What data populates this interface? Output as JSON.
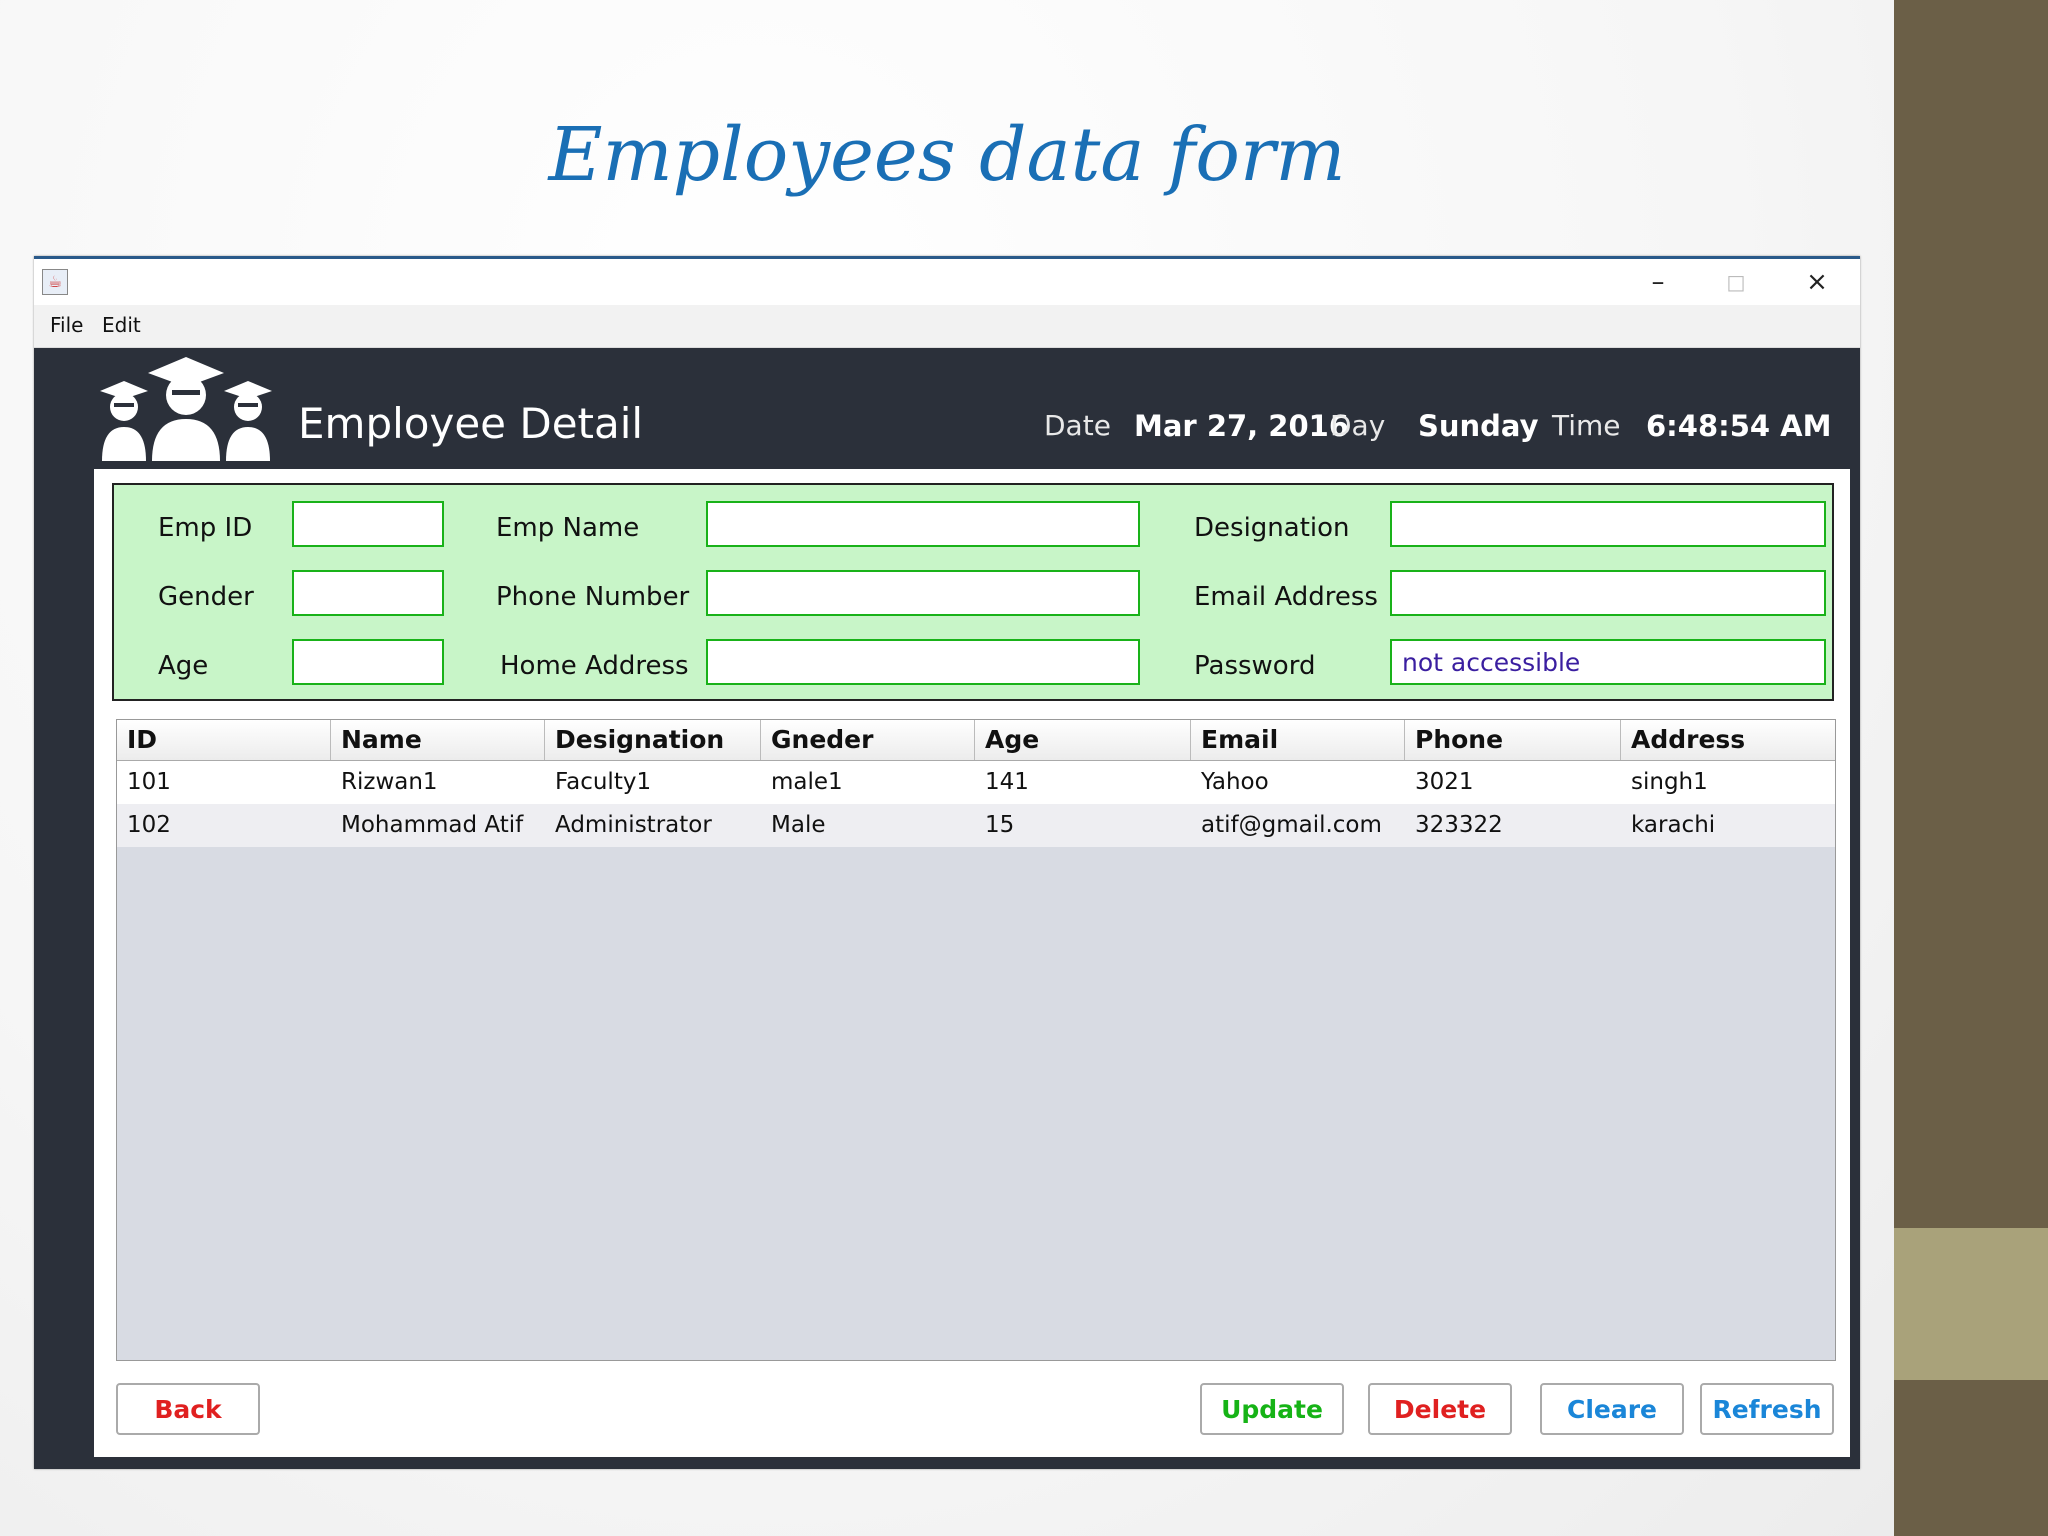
{
  "slide": {
    "title": "Employees data form"
  },
  "window": {
    "menu": [
      "File",
      "Edit"
    ],
    "controls": {
      "minimize": "–",
      "maximize": "□",
      "close": "×"
    }
  },
  "header": {
    "title": "Employee Detail",
    "icon": "graduates-icon",
    "date_label": "Date",
    "date_value": "Mar 27, 2016",
    "day_label": "Day",
    "day_value": "Sunday",
    "time_label": "Time",
    "time_value": "6:48:54 AM"
  },
  "form": {
    "emp_id": {
      "label": "Emp ID",
      "value": ""
    },
    "emp_name": {
      "label": "Emp Name",
      "value": ""
    },
    "designation": {
      "label": "Designation",
      "value": ""
    },
    "gender": {
      "label": "Gender",
      "value": ""
    },
    "phone": {
      "label": "Phone Number",
      "value": ""
    },
    "email": {
      "label": "Email Address",
      "value": ""
    },
    "age": {
      "label": "Age",
      "value": ""
    },
    "address": {
      "label": "Home Address",
      "value": ""
    },
    "password": {
      "label": "Password",
      "value": "not accessible"
    }
  },
  "table": {
    "columns": [
      "ID",
      "Name",
      "Designation",
      "Gneder",
      "Age",
      "Email",
      "Phone",
      "Address"
    ],
    "rows": [
      [
        "101",
        "Rizwan1",
        "Faculty1",
        "male1",
        "141",
        "Yahoo",
        "3021",
        "singh1"
      ],
      [
        "102",
        "Mohammad Atif",
        "Administrator",
        "Male",
        "15",
        "atif@gmail.com",
        "323322",
        "karachi"
      ]
    ]
  },
  "buttons": {
    "back": {
      "label": "Back",
      "color": "#e02020"
    },
    "update": {
      "label": "Update",
      "color": "#16b316"
    },
    "delete": {
      "label": "Delete",
      "color": "#e02020"
    },
    "clear": {
      "label": "Cleare",
      "color": "#1a86d8"
    },
    "refresh": {
      "label": "Refresh",
      "color": "#1a86d8"
    }
  },
  "colors": {
    "form_bg": "#c8f5c8",
    "input_border": "#19b219",
    "header_bg": "#2b303a",
    "slide_title": "#1a6fb5"
  }
}
